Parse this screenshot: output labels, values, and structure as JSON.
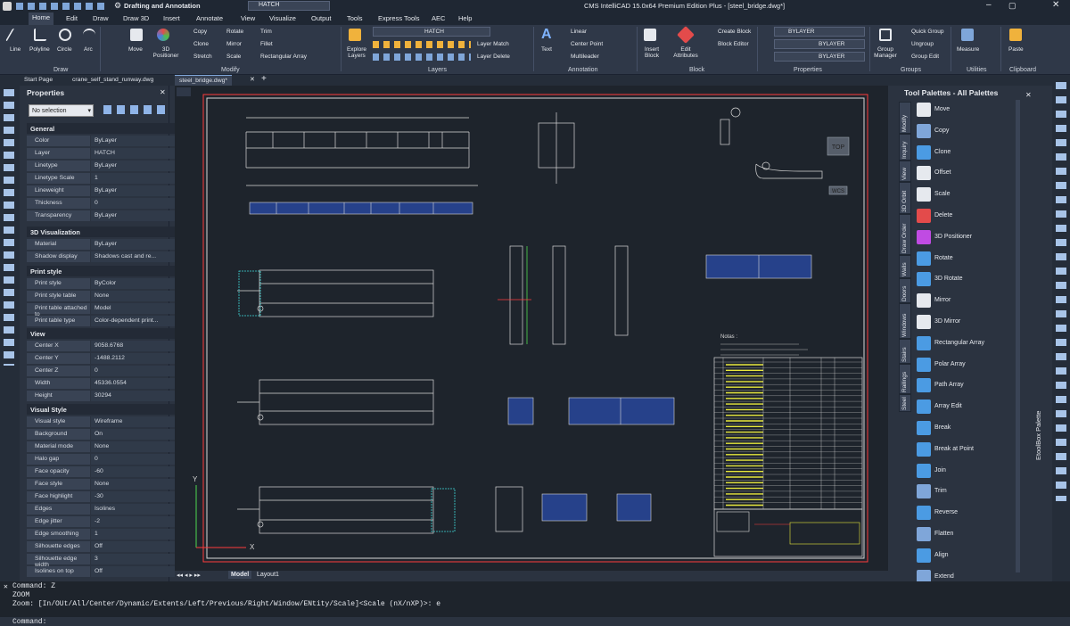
{
  "titlebar": {
    "workspace": "Drafting and Annotation",
    "layer": "HATCH",
    "title": "CMS IntelliCAD 15.0x64 Premium Edition Plus - [steel_bridge.dwg*]"
  },
  "menu": [
    "Home",
    "Edit",
    "Draw",
    "Draw 3D",
    "Insert",
    "Annotate",
    "View",
    "Visualize",
    "Output",
    "Tools",
    "Express Tools",
    "AEC",
    "Help"
  ],
  "ribbon": {
    "draw": {
      "line": "Line",
      "polyline": "Polyline",
      "circle": "Circle",
      "arc": "Arc",
      "label": "Draw"
    },
    "modify": {
      "move": "Move",
      "positioner": "3D Positioner",
      "copy": "Copy",
      "clone": "Clone",
      "stretch": "Stretch",
      "rotate": "Rotate",
      "mirror": "Mirror",
      "scale": "Scale",
      "trim": "Trim",
      "fillet": "Fillet",
      "rect_array": "Rectangular Array",
      "label": "Modify"
    },
    "layers": {
      "explore": "Explore Layers",
      "layer_name": "HATCH",
      "layer_match": "Layer Match",
      "layer_delete": "Layer Delete",
      "label": "Layers"
    },
    "annotation": {
      "text": "Text",
      "linear": "Linear",
      "center_point": "Center Point",
      "multileader": "Multileader",
      "label": "Annotation"
    },
    "block": {
      "insert": "Insert Block",
      "edit_attr": "Edit Attributes",
      "create": "Create Block",
      "editor": "Block Editor",
      "label": "Block"
    },
    "properties": {
      "color": "BYLAYER",
      "linetype": "BYLAYER",
      "lineweight": "BYLAYER",
      "label": "Properties"
    },
    "groups": {
      "manager": "Group Manager",
      "quick": "Quick Group",
      "ungroup": "Ungroup",
      "edit": "Group Edit",
      "label": "Groups"
    },
    "utilities": {
      "measure": "Measure",
      "label": "Utilities"
    },
    "clipboard": {
      "paste": "Paste",
      "label": "Clipboard"
    }
  },
  "doc_tabs": [
    "Start Page",
    "crane_self_stand_runway.dwg",
    "steel_bridge.dwg*"
  ],
  "properties_panel": {
    "title": "Properties",
    "selection": "No selection",
    "general": {
      "title": "General",
      "rows": [
        [
          "Color",
          "ByLayer"
        ],
        [
          "Layer",
          "HATCH"
        ],
        [
          "Linetype",
          "ByLayer"
        ],
        [
          "Linetype Scale",
          "1"
        ],
        [
          "Lineweight",
          "ByLayer"
        ],
        [
          "Thickness",
          "0"
        ],
        [
          "Transparency",
          "ByLayer"
        ]
      ]
    },
    "viz3d": {
      "title": "3D Visualization",
      "rows": [
        [
          "Material",
          "ByLayer"
        ],
        [
          "Shadow display",
          "Shadows cast and re..."
        ]
      ]
    },
    "print": {
      "title": "Print style",
      "rows": [
        [
          "Print style",
          "ByColor"
        ],
        [
          "Print style table",
          "None"
        ],
        [
          "Print table attached to",
          "Model"
        ],
        [
          "Print table type",
          "Color-dependent print..."
        ]
      ]
    },
    "view": {
      "title": "View",
      "rows": [
        [
          "Center X",
          "9058.6768"
        ],
        [
          "Center Y",
          "-1488.2112"
        ],
        [
          "Center Z",
          "0"
        ],
        [
          "Width",
          "45336.0554"
        ],
        [
          "Height",
          "30294"
        ]
      ]
    },
    "visual": {
      "title": "Visual Style",
      "rows": [
        [
          "Visual style",
          "Wireframe"
        ],
        [
          "Background",
          "On"
        ],
        [
          "Material mode",
          "None"
        ],
        [
          "Halo gap",
          "0"
        ],
        [
          "Face opacity",
          "-60"
        ],
        [
          "Face style",
          "None"
        ],
        [
          "Face highlight",
          "-30"
        ],
        [
          "Edges",
          "Isolines"
        ],
        [
          "Edge jitter",
          "-2"
        ],
        [
          "Edge smoothing",
          "1"
        ],
        [
          "Silhouette edges",
          "Off"
        ],
        [
          "Silhouette edge width",
          "3"
        ],
        [
          "Isolines on top",
          "Off"
        ]
      ]
    }
  },
  "canvas": {
    "viewcube": "TOP",
    "wcs": "WCS",
    "x_axis": "X",
    "y_axis": "Y",
    "notes_title": "Notas :"
  },
  "layout_tabs": [
    "Model",
    "Layout1"
  ],
  "palette": {
    "title": "Tool Palettes - All Palettes",
    "side_label": "EtoolBox Palette",
    "tabs": [
      "Modify",
      "Inquiry",
      "View",
      "3D Orbit",
      "Draw Order",
      "Walls",
      "Doors",
      "Windows",
      "Stairs",
      "Railings",
      "Steel"
    ],
    "items": [
      "Move",
      "Copy",
      "Clone",
      "Offset",
      "Scale",
      "Delete",
      "3D Positioner",
      "Rotate",
      "3D Rotate",
      "Mirror",
      "3D Mirror",
      "Rectangular Array",
      "Polar Array",
      "Path Array",
      "Array Edit",
      "Break",
      "Break at Point",
      "Join",
      "Trim",
      "Reverse",
      "Flatten",
      "Align",
      "Extend"
    ]
  },
  "command": {
    "lines": [
      "Command: Z",
      "ZOOM",
      "Zoom:  [In/OUt/All/Center/Dynamic/Extents/Left/Previous/Right/Window/ENtity/Scale]<Scale (nX/nXP)>: e"
    ],
    "prompt": "Command:"
  }
}
